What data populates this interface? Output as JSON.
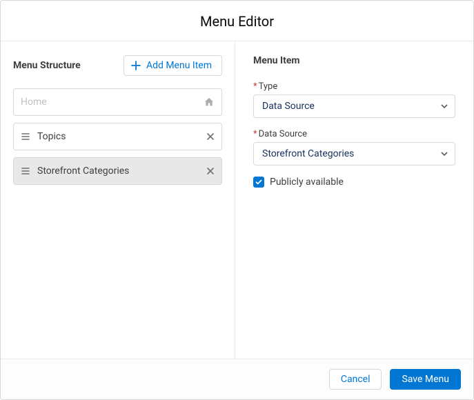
{
  "title": "Menu Editor",
  "left": {
    "heading": "Menu Structure",
    "add_label": "Add Menu Item",
    "items": [
      {
        "label": "Home"
      },
      {
        "label": "Topics"
      },
      {
        "label": "Storefront Categories"
      }
    ]
  },
  "right": {
    "heading": "Menu Item",
    "type_label": "Type",
    "type_value": "Data Source",
    "datasource_label": "Data Source",
    "datasource_value": "Storefront Categories",
    "public_label": "Publicly available",
    "public_checked": true
  },
  "footer": {
    "cancel": "Cancel",
    "save": "Save Menu"
  },
  "colors": {
    "brand": "#0176d3",
    "danger": "#c23934"
  }
}
